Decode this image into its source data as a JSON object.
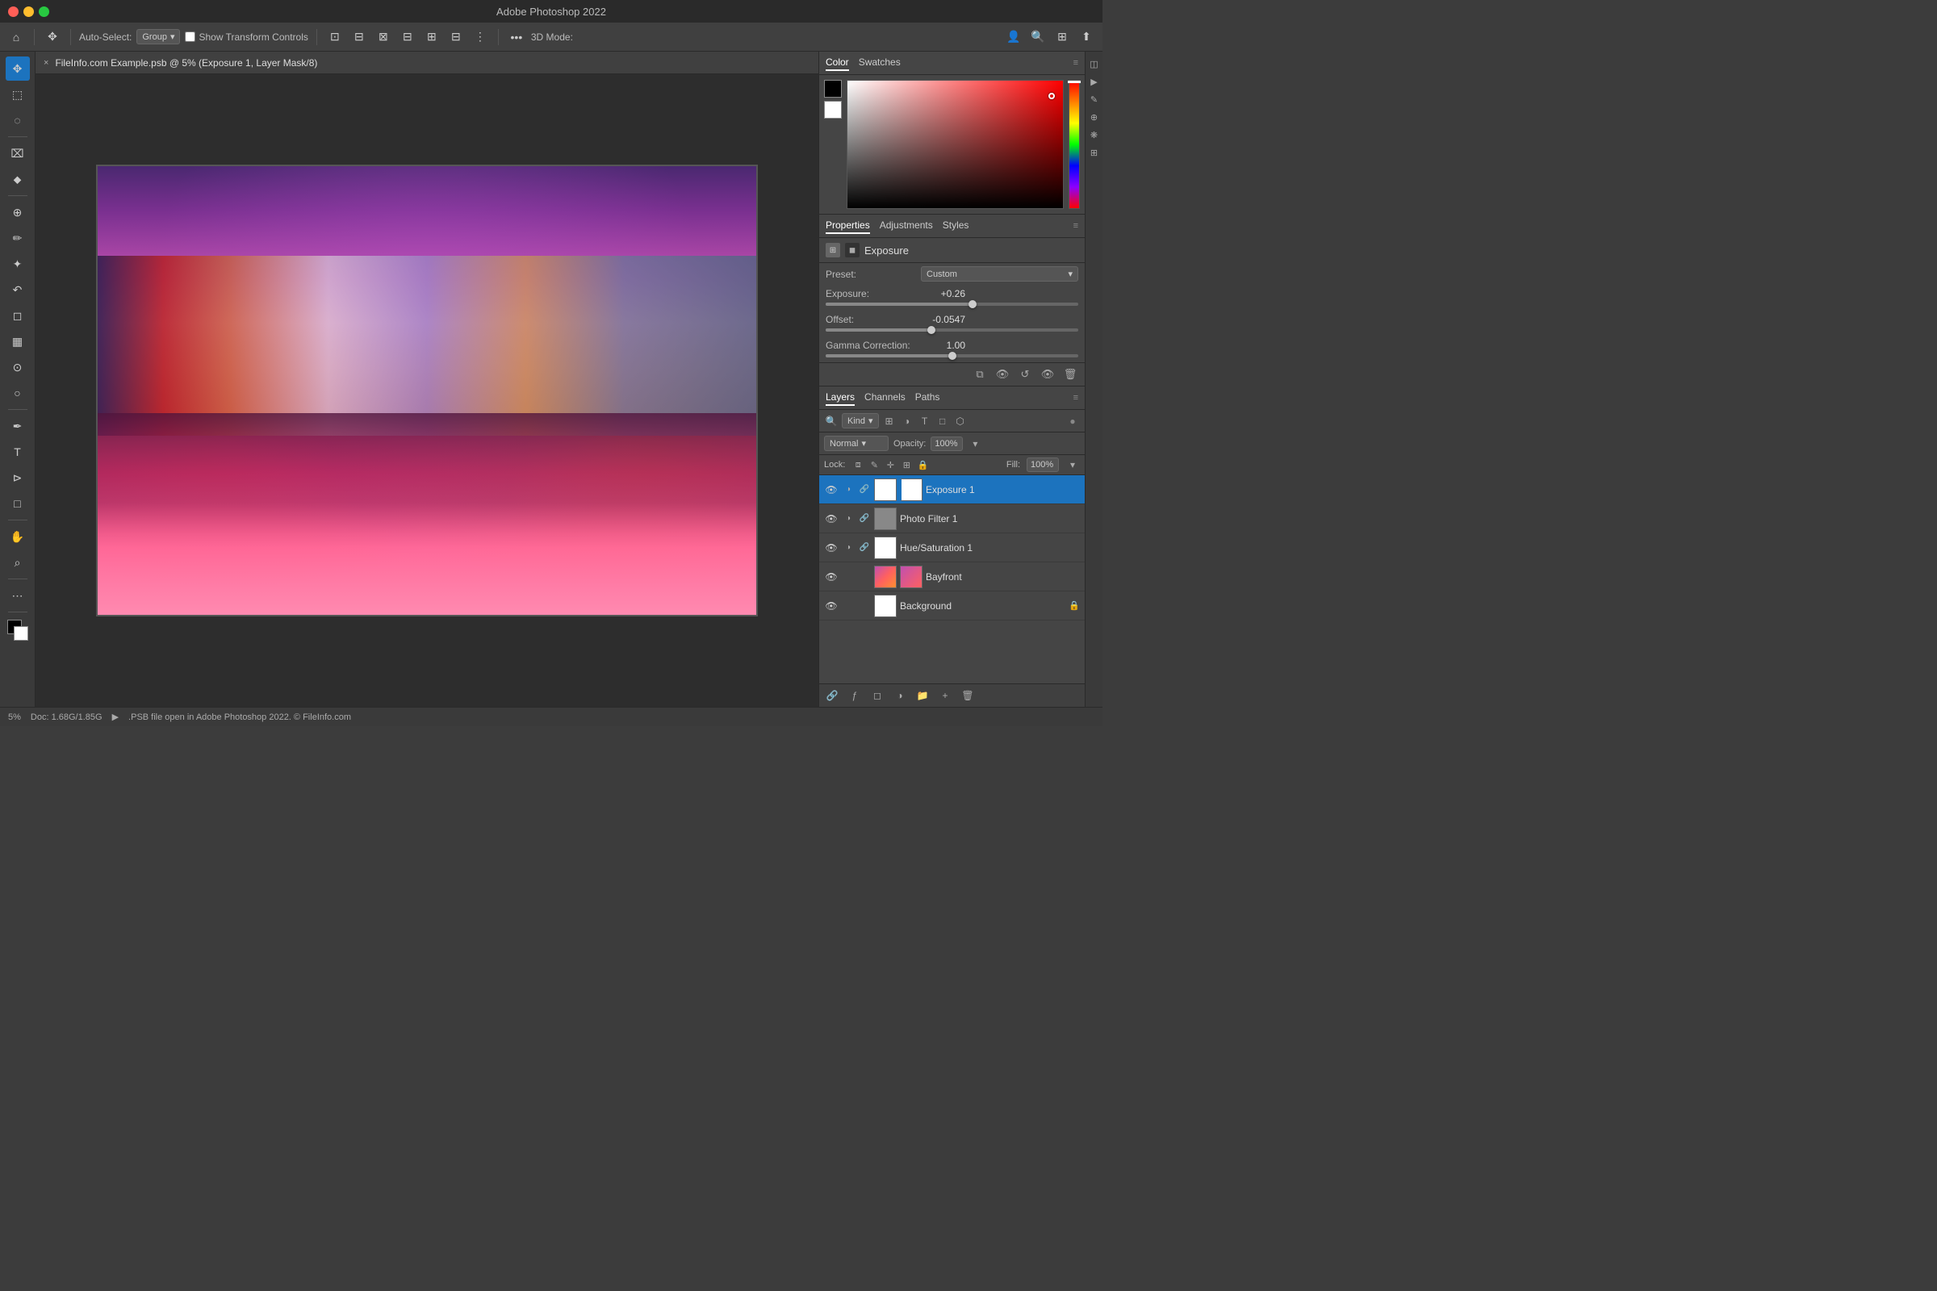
{
  "app": {
    "title": "Adobe Photoshop 2022",
    "window_controls": {
      "close": "●",
      "minimize": "●",
      "maximize": "●"
    }
  },
  "toolbar": {
    "move_tool": "✥",
    "auto_select_label": "Auto-Select:",
    "auto_select_value": "Group",
    "show_transform_controls_label": "Show Transform Controls",
    "mode_3d_label": "3D Mode:",
    "more_icon": "•••"
  },
  "canvas": {
    "tab_title": "FileInfo.com Example.psb @ 5% (Exposure 1, Layer Mask/8)",
    "close_icon": "×"
  },
  "color_panel": {
    "tab_color": "Color",
    "tab_swatches": "Swatches"
  },
  "properties_panel": {
    "tab_properties": "Properties",
    "tab_adjustments": "Adjustments",
    "tab_styles": "Styles",
    "adjustment_name": "Exposure",
    "preset_label": "Preset:",
    "preset_value": "Custom",
    "exposure_label": "Exposure:",
    "exposure_value": "+0.26",
    "exposure_thumb_pct": 58,
    "offset_label": "Offset:",
    "offset_value": "-0.0547",
    "offset_thumb_pct": 42,
    "gamma_label": "Gamma Correction:",
    "gamma_value": "1.00",
    "gamma_thumb_pct": 50
  },
  "layers_panel": {
    "tab_layers": "Layers",
    "tab_channels": "Channels",
    "tab_paths": "Paths",
    "filter_label": "Kind",
    "blend_mode": "Normal",
    "opacity_label": "Opacity:",
    "opacity_value": "100%",
    "lock_label": "Lock:",
    "fill_label": "Fill:",
    "fill_value": "100%",
    "layers": [
      {
        "id": "exposure1",
        "name": "Exposure 1",
        "visible": true,
        "type": "adjustment",
        "active": true,
        "thumb": "white-mask",
        "has_mask": true
      },
      {
        "id": "photo-filter1",
        "name": "Photo Filter 1",
        "visible": true,
        "type": "adjustment",
        "active": false,
        "thumb": "white-mask",
        "has_mask": false
      },
      {
        "id": "hue-saturation1",
        "name": "Hue/Saturation 1",
        "visible": true,
        "type": "adjustment",
        "active": false,
        "thumb": "white-mask",
        "has_mask": false
      },
      {
        "id": "bayfront",
        "name": "Bayfront",
        "visible": true,
        "type": "image",
        "active": false,
        "thumb": "img",
        "has_mask": false
      },
      {
        "id": "background",
        "name": "Background",
        "visible": true,
        "type": "image",
        "active": false,
        "thumb": "white",
        "has_mask": false,
        "locked": true
      }
    ]
  },
  "status_bar": {
    "zoom": "5%",
    "doc_size": "Doc: 1.68G/1.85G",
    "info": ".PSB file open in Adobe Photoshop 2022. © FileInfo.com"
  },
  "left_tools": [
    {
      "id": "move",
      "icon": "✥",
      "active": true
    },
    {
      "id": "selection",
      "icon": "⬚"
    },
    {
      "id": "lasso",
      "icon": "◌"
    },
    {
      "id": "crop",
      "icon": "⌧"
    },
    {
      "id": "eyedropper",
      "icon": "⬥"
    },
    {
      "id": "heal",
      "icon": "⊕"
    },
    {
      "id": "brush",
      "icon": "✏"
    },
    {
      "id": "stamp",
      "icon": "✦"
    },
    {
      "id": "history",
      "icon": "↶"
    },
    {
      "id": "eraser",
      "icon": "◻"
    },
    {
      "id": "gradient",
      "icon": "▦"
    },
    {
      "id": "blur",
      "icon": "⊙"
    },
    {
      "id": "dodge",
      "icon": "○"
    },
    {
      "id": "pen",
      "icon": "✒"
    },
    {
      "id": "text",
      "icon": "T"
    },
    {
      "id": "path-select",
      "icon": "⊳"
    },
    {
      "id": "shape",
      "icon": "□"
    },
    {
      "id": "hand",
      "icon": "✋"
    },
    {
      "id": "zoom",
      "icon": "🔍"
    },
    {
      "id": "more",
      "icon": "⋯"
    }
  ]
}
